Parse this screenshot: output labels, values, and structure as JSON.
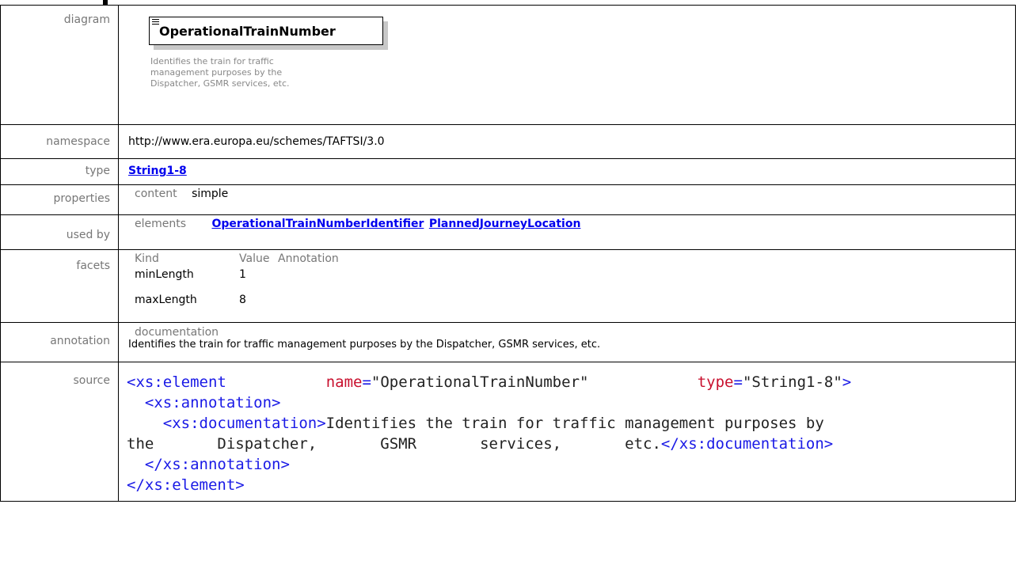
{
  "rows": {
    "diagram": {
      "label": "diagram",
      "element_name": "OperationalTrainNumber",
      "doc_lines": [
        "Identifies the train for traffic",
        "management purposes by the",
        "Dispatcher, GSMR services, etc."
      ]
    },
    "namespace": {
      "label": "namespace",
      "value": "http://www.era.europa.eu/schemes/TAFTSI/3.0"
    },
    "type": {
      "label": "type",
      "value": "String1-8"
    },
    "properties": {
      "label": "properties",
      "key": "content",
      "value": "simple"
    },
    "used_by": {
      "label": "used by",
      "key": "elements",
      "links": [
        "OperationalTrainNumberIdentifier",
        "PlannedJourneyLocation"
      ]
    },
    "facets": {
      "label": "facets",
      "headers": [
        "Kind",
        "Value",
        "Annotation"
      ],
      "rows": [
        {
          "kind": "minLength",
          "value": "1"
        },
        {
          "kind": "maxLength",
          "value": "8"
        }
      ]
    },
    "annotation": {
      "label": "annotation",
      "key": "documentation",
      "text": "Identifies the train for traffic management purposes by the Dispatcher, GSMR services, etc."
    },
    "source": {
      "label": "source",
      "line1": {
        "open": "<xs:element",
        "a1": "name",
        "v1": "\"OperationalTrainNumber\"",
        "a2": "type",
        "v2": "\"String1-8\"",
        "close": ">"
      },
      "line2": "<xs:annotation>",
      "line3a": "<xs:documentation>",
      "line3b": "Identifies the train for traffic management purposes by",
      "line4": "the       Dispatcher,       GSMR       services,       etc.",
      "line4c": "</xs:documentation>",
      "line5": "</xs:annotation>",
      "line6": "</xs:element>"
    }
  },
  "colors": {
    "label_gray": "#777777",
    "link": "#0000ee",
    "xml_tag": "#9b1b30",
    "xml_bracket": "#1a1ae6",
    "xml_attr": "#c8102e"
  }
}
